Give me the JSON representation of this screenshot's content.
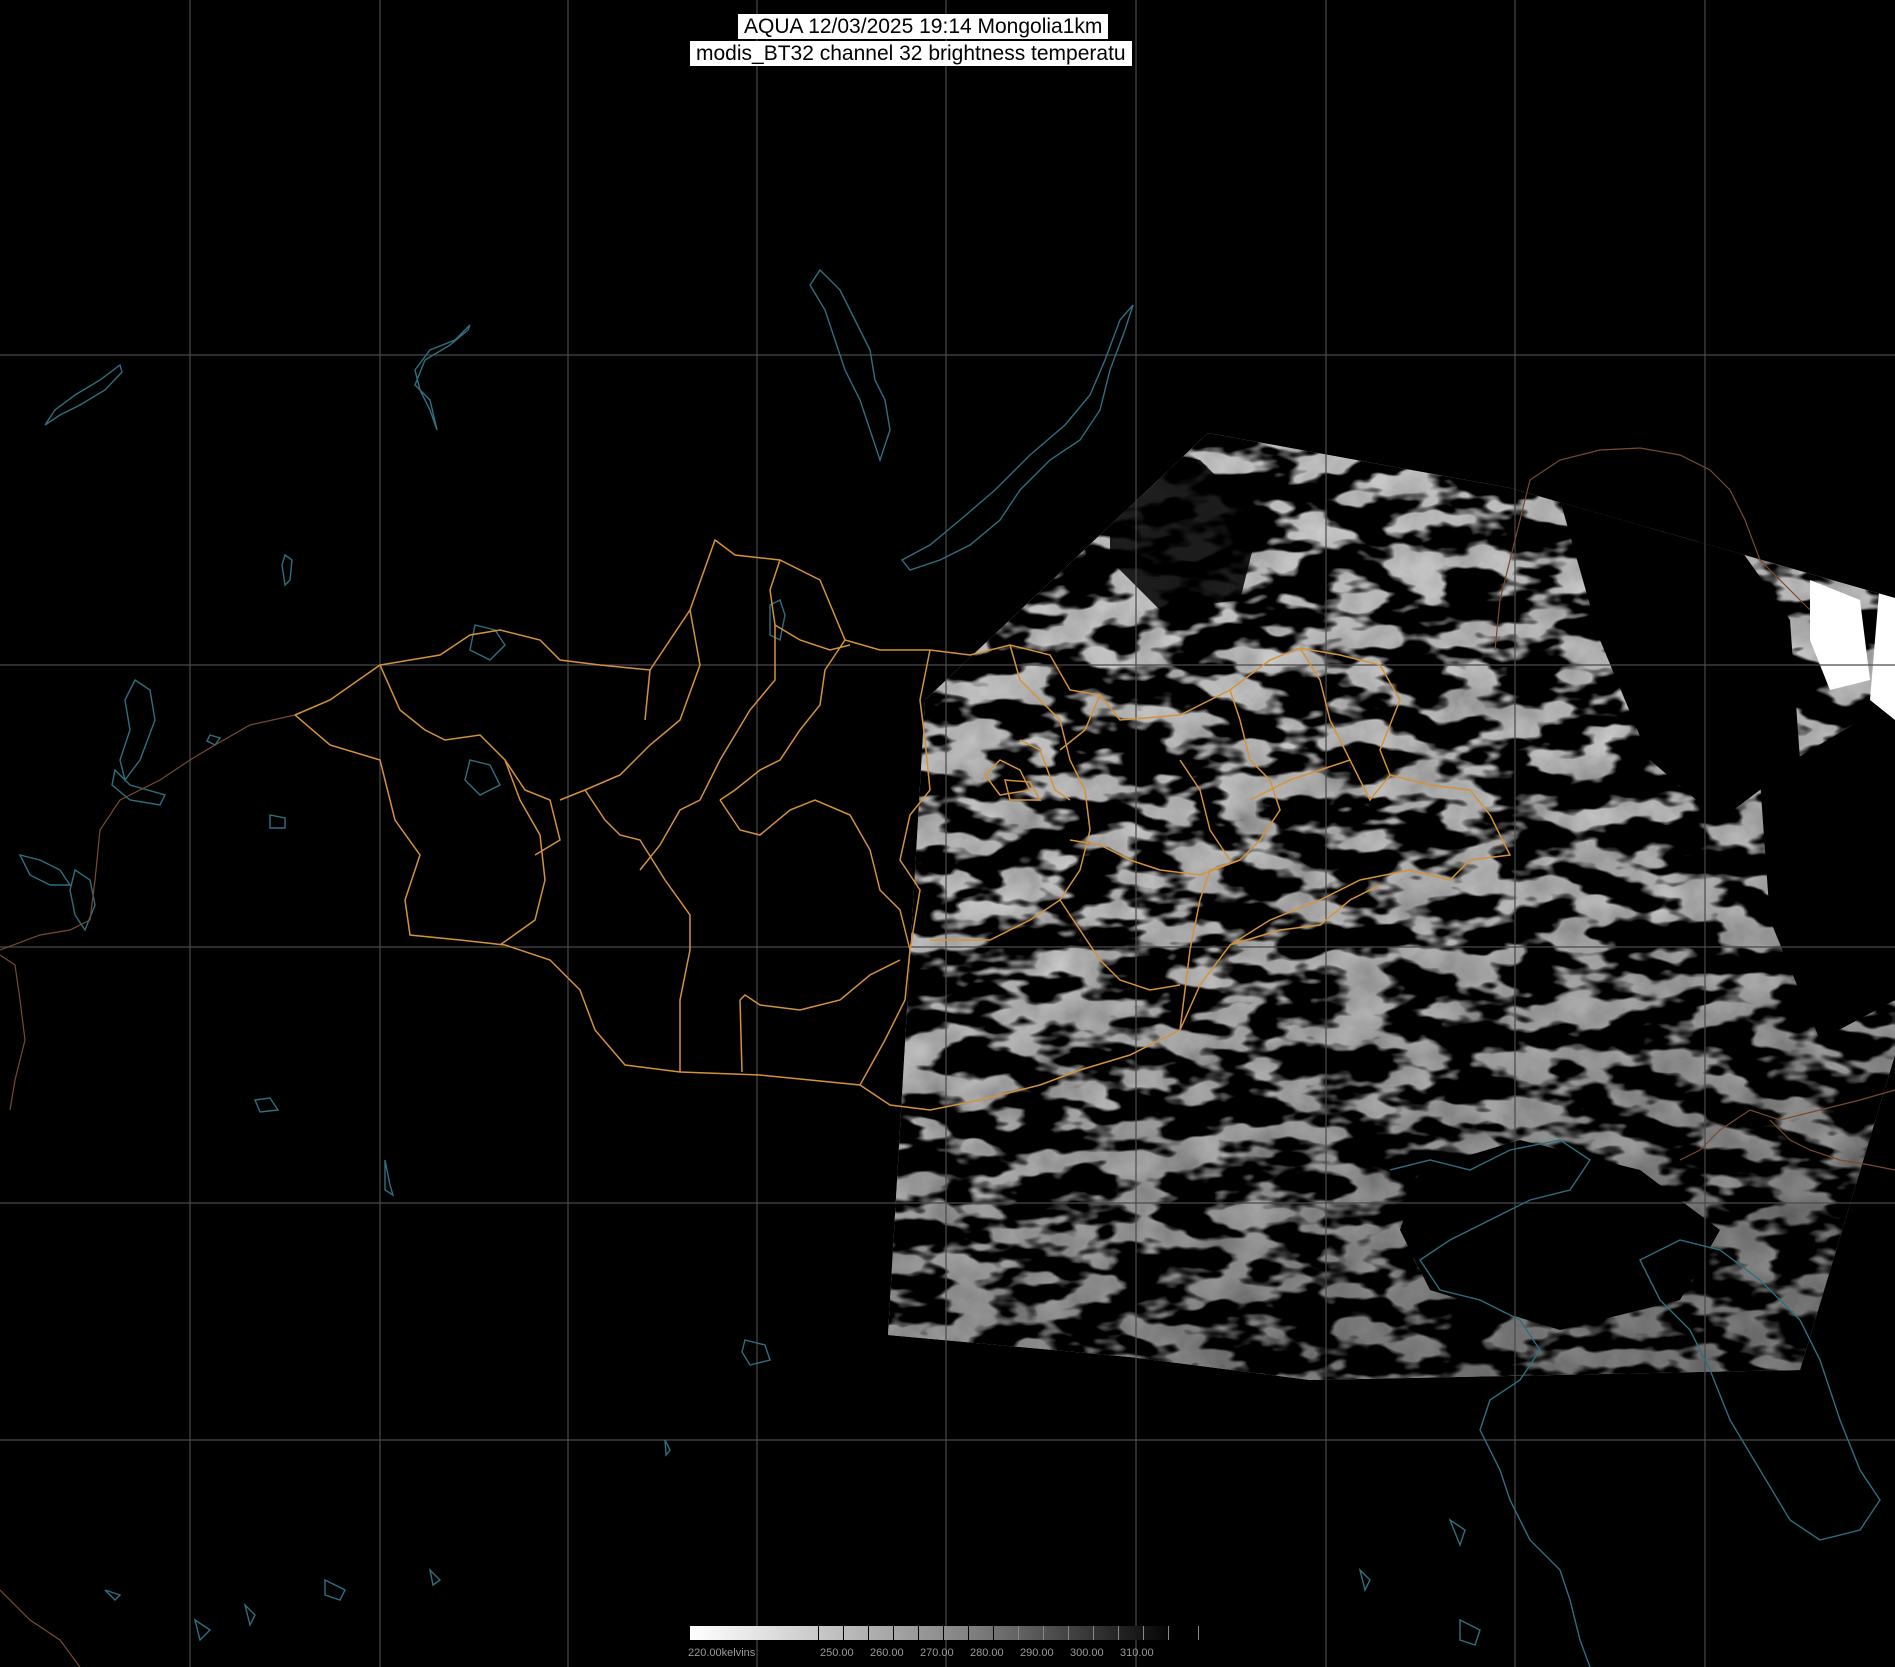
{
  "header": {
    "title_line1": "AQUA 12/03/2025 19:14 Mongolia1km",
    "title_line2": "modis_BT32 channel 32 brightness temperatu"
  },
  "colorbar": {
    "labels": [
      "220.00kelvins",
      "250.00",
      "260.00",
      "270.00",
      "280.00",
      "290.00",
      "300.00",
      "310.00"
    ]
  },
  "colors": {
    "background": "#000000",
    "gridlines": "#4a4a4a",
    "borders": "#d4933a",
    "coast_water": "#2e6f80"
  }
}
